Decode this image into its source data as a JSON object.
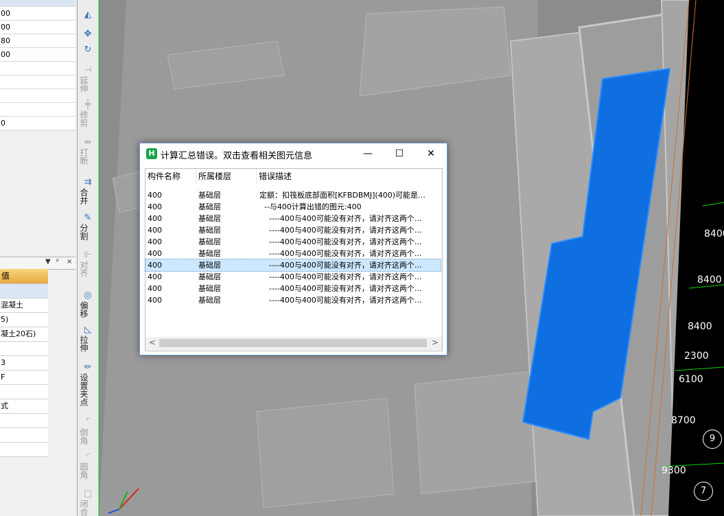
{
  "left_panel": {
    "top_rows": [
      "00",
      "00",
      "80",
      "00",
      "",
      "",
      "",
      "",
      "0"
    ],
    "panel2_buttons": [
      "▼",
      "ᵖ",
      "×"
    ],
    "table_header": "值",
    "cells": [
      "",
      "混凝土",
      "5)",
      "凝土20石)",
      "",
      "3",
      "F",
      "",
      "式",
      "",
      "",
      ""
    ]
  },
  "toolbar": {
    "items": [
      {
        "icon": "mirror-icon",
        "glyph": "◭",
        "label": ""
      },
      {
        "icon": "move-icon",
        "glyph": "✥",
        "label": ""
      },
      {
        "icon": "rotate-icon",
        "glyph": "↻",
        "label": ""
      },
      {
        "icon": "extend-icon",
        "glyph": "⊣",
        "label": "延伸"
      },
      {
        "icon": "trim-icon",
        "glyph": "╪",
        "label": "修剪"
      },
      {
        "icon": "break-icon",
        "glyph": "⇹",
        "label": "打断"
      },
      {
        "icon": "merge-icon",
        "glyph": "⇉",
        "label": "合并"
      },
      {
        "icon": "split-icon",
        "glyph": "✎",
        "label": "分割"
      },
      {
        "icon": "align-icon",
        "glyph": "⊩",
        "label": "对齐"
      },
      {
        "icon": "offset-icon",
        "glyph": "◎",
        "label": "偏移"
      },
      {
        "icon": "stretch-icon",
        "glyph": "◺",
        "label": "拉伸"
      },
      {
        "icon": "set-grip-icon",
        "glyph": "✏",
        "label": "设置夹点"
      },
      {
        "icon": "chamfer-icon",
        "glyph": "⌜",
        "label": "倒角"
      },
      {
        "icon": "fillet-icon",
        "glyph": "◜",
        "label": "圆角"
      },
      {
        "icon": "close-shape-icon",
        "glyph": "□",
        "label": "闭合"
      }
    ]
  },
  "viewport": {
    "axis_labels": [
      "8400",
      "8400",
      "8400",
      "2300",
      "6100",
      "8700",
      "9300"
    ],
    "grid_circles": [
      "9",
      "7"
    ],
    "selection_color": "#0f6fe0"
  },
  "dialog": {
    "title": "计算汇总错误。双击查看相关图元信息",
    "buttons": {
      "minimize": "—",
      "maximize": "☐",
      "close": "✕"
    },
    "columns": [
      "构件名称",
      "所属楼层",
      "错误描述"
    ],
    "rows": [
      {
        "name": "400",
        "floor": "基础层",
        "desc": "定额：扣筏板底部面积[KFBDBMJ](400)可能是…"
      },
      {
        "name": "400",
        "floor": "基础层",
        "desc": "  --与400计算出错的图元:400"
      },
      {
        "name": "400",
        "floor": "基础层",
        "desc": "    ----400与400可能没有对齐，请对齐这两个…"
      },
      {
        "name": "400",
        "floor": "基础层",
        "desc": "    ----400与400可能没有对齐，请对齐这两个…"
      },
      {
        "name": "400",
        "floor": "基础层",
        "desc": "    ----400与400可能没有对齐，请对齐这两个…"
      },
      {
        "name": "400",
        "floor": "基础层",
        "desc": "    ----400与400可能没有对齐，请对齐这两个…"
      },
      {
        "name": "400",
        "floor": "基础层",
        "desc": "    ----400与400可能没有对齐，请对齐这两个…",
        "selected": true
      },
      {
        "name": "400",
        "floor": "基础层",
        "desc": "    ----400与400可能没有对齐，请对齐这两个…"
      },
      {
        "name": "400",
        "floor": "基础层",
        "desc": "    ----400与400可能没有对齐，请对齐这两个…"
      },
      {
        "name": "400",
        "floor": "基础层",
        "desc": "    ----400与400可能没有对齐，请对齐这两个…"
      }
    ],
    "scroll_left": "<",
    "scroll_right": ">"
  }
}
